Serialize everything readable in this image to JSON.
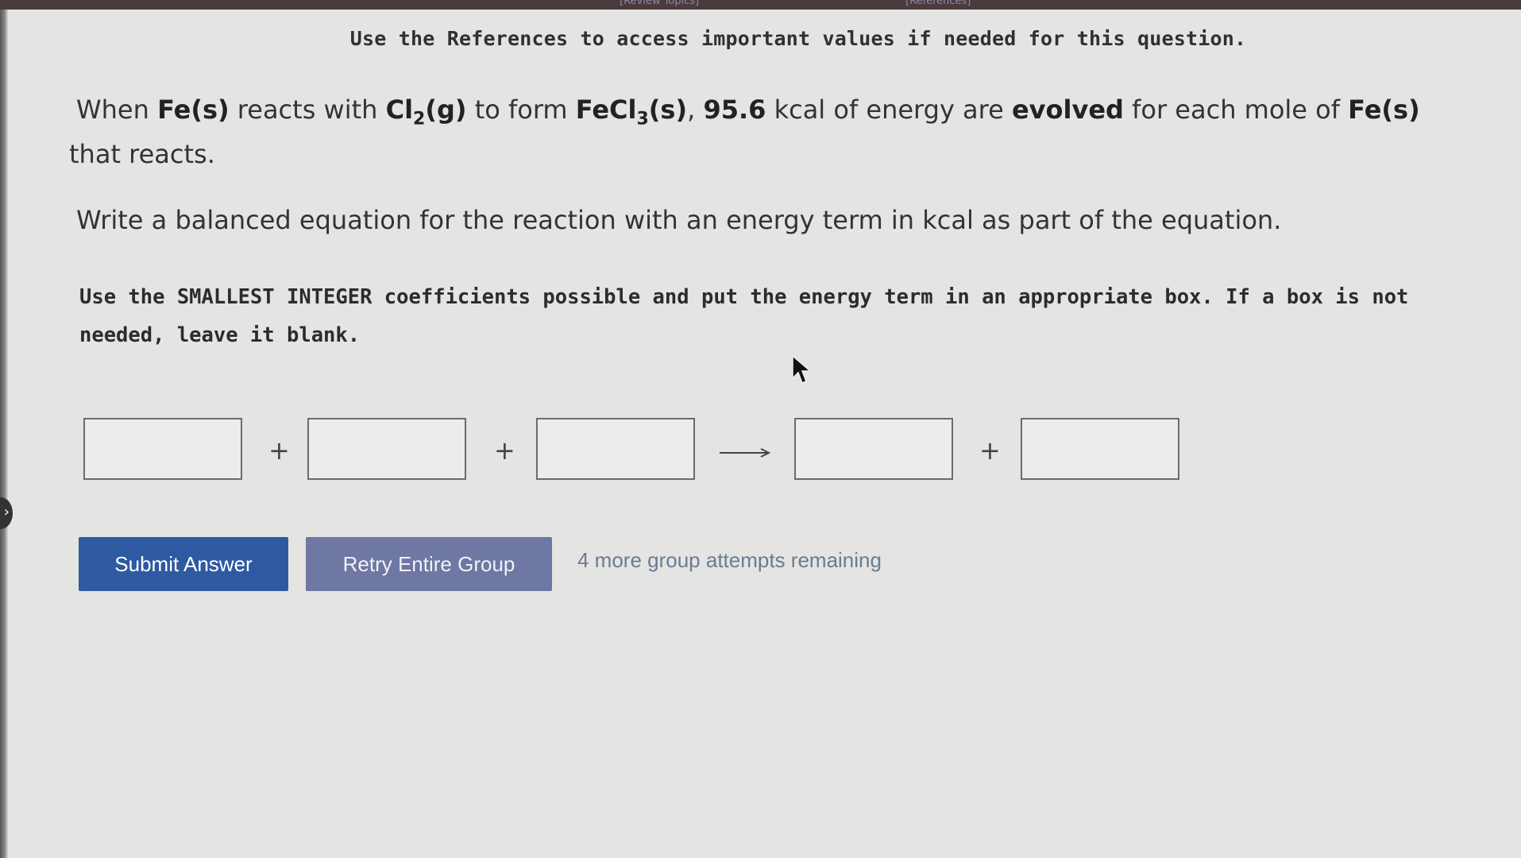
{
  "header": {
    "review_topics": "[Review Topics]",
    "references": "[References]",
    "refs_note": "Use the References to access important values if needed for this question."
  },
  "question": {
    "p1_when": "When ",
    "p1_fe": "Fe(s)",
    "p1_reacts_with": " reacts with ",
    "p1_cl": "Cl",
    "p1_cl_sub": "2",
    "p1_cl_state": "(g)",
    "p1_to_form": " to form ",
    "p1_fecl": "FeCl",
    "p1_fecl_sub": "3",
    "p1_fecl_state": "(s)",
    "p1_comma": ", ",
    "p1_energy": "95.6",
    "p1_kcal": " kcal of energy are ",
    "p1_evolved": "evolved",
    "p1_for_each": " for each mole of ",
    "p1_fe2": "Fe(s)",
    "p1_end": " that reacts.",
    "p2": "Write a balanced equation for the reaction with an energy term in kcal as part of the equation.",
    "instructions": "Use the SMALLEST INTEGER coefficients possible and put the energy term in an appropriate box. If a box is not needed, leave it blank."
  },
  "equation": {
    "plus_1": "+",
    "plus_2": "+",
    "plus_3": "+",
    "box_1": "",
    "box_2": "",
    "box_3": "",
    "box_4": "",
    "box_5": ""
  },
  "actions": {
    "submit_label": "Submit Answer",
    "retry_label": "Retry Entire Group",
    "attempts_text": "4 more group attempts remaining"
  },
  "icons": {
    "cursor": "mouse-pointer-icon",
    "arrow": "reaction-arrow-icon"
  },
  "colors": {
    "submit": "#2e5aa2",
    "retry": "#6f77a3",
    "attempts": "#6a7c94"
  }
}
